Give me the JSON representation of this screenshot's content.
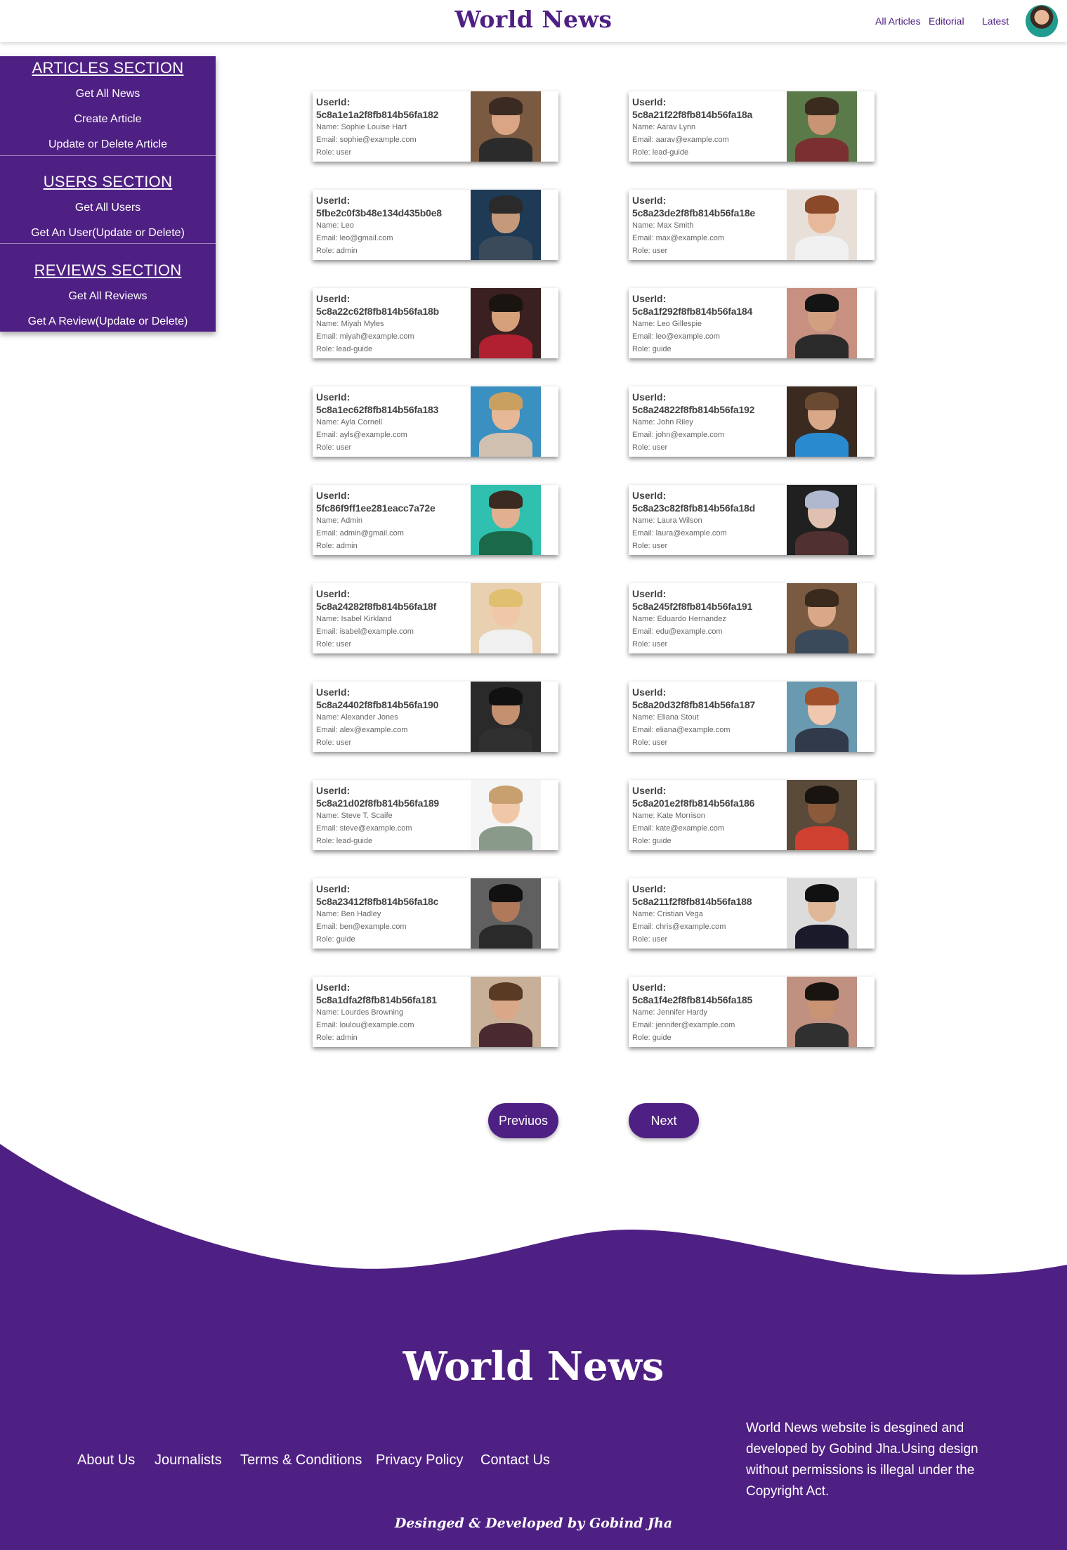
{
  "header": {
    "brand": "World News",
    "nav": [
      "All Articles",
      "Editorial",
      "Latest"
    ]
  },
  "sidebar": {
    "sections": [
      {
        "title": "ARTICLES SECTION",
        "links": [
          "Get All News",
          "Create Article",
          "Update or Delete Article"
        ]
      },
      {
        "title": "USERS SECTION",
        "links": [
          "Get All Users",
          "Get An User(Update or Delete)"
        ]
      },
      {
        "title": "REVIEWS SECTION",
        "links": [
          "Get All Reviews",
          "Get A Review(Update or Delete)"
        ]
      }
    ]
  },
  "users": [
    {
      "label": "UserId:",
      "id": "5c8a1e1a2f8fb814b56fa182",
      "name": "Name: Sophie Louise Hart",
      "email": "Email: sophie@example.com",
      "role": "Role: user"
    },
    {
      "label": "UserId:",
      "id": "5c8a21f22f8fb814b56fa18a",
      "name": "Name: Aarav Lynn",
      "email": "Email: aarav@example.com",
      "role": "Role: lead-guide"
    },
    {
      "label": "UserId:",
      "id": "5fbe2c0f3b48e134d435b0e8",
      "name": "Name: Leo",
      "email": "Email: leo@gmail.com",
      "role": "Role: admin"
    },
    {
      "label": "UserId:",
      "id": "5c8a23de2f8fb814b56fa18e",
      "name": "Name: Max Smith",
      "email": "Email: max@example.com",
      "role": "Role: user"
    },
    {
      "label": "UserId:",
      "id": "5c8a22c62f8fb814b56fa18b",
      "name": "Name: Miyah Myles",
      "email": "Email: miyah@example.com",
      "role": "Role: lead-guide"
    },
    {
      "label": "UserId:",
      "id": "5c8a1f292f8fb814b56fa184",
      "name": "Name: Leo Gillespie",
      "email": "Email: leo@example.com",
      "role": "Role: guide"
    },
    {
      "label": "UserId:",
      "id": "5c8a1ec62f8fb814b56fa183",
      "name": "Name: Ayla Cornell",
      "email": "Email: ayls@example.com",
      "role": "Role: user"
    },
    {
      "label": "UserId:",
      "id": "5c8a24822f8fb814b56fa192",
      "name": "Name: John Riley",
      "email": "Email: john@example.com",
      "role": "Role: user"
    },
    {
      "label": "UserId:",
      "id": "5fc86f9ff1ee281eacc7a72e",
      "name": "Name: Admin",
      "email": "Email: admin@gmail.com",
      "role": "Role: admin"
    },
    {
      "label": "UserId:",
      "id": "5c8a23c82f8fb814b56fa18d",
      "name": "Name: Laura Wilson",
      "email": "Email: laura@example.com",
      "role": "Role: user"
    },
    {
      "label": "UserId:",
      "id": "5c8a24282f8fb814b56fa18f",
      "name": "Name: Isabel Kirkland",
      "email": "Email: isabel@example.com",
      "role": "Role: user"
    },
    {
      "label": "UserId:",
      "id": "5c8a245f2f8fb814b56fa191",
      "name": "Name: Eduardo Hernandez",
      "email": "Email: edu@example.com",
      "role": "Role: user"
    },
    {
      "label": "UserId:",
      "id": "5c8a24402f8fb814b56fa190",
      "name": "Name: Alexander Jones",
      "email": "Email: alex@example.com",
      "role": "Role: user"
    },
    {
      "label": "UserId:",
      "id": "5c8a20d32f8fb814b56fa187",
      "name": "Name: Eliana Stout",
      "email": "Email: eliana@example.com",
      "role": "Role: user"
    },
    {
      "label": "UserId:",
      "id": "5c8a21d02f8fb814b56fa189",
      "name": "Name: Steve T. Scaife",
      "email": "Email: steve@example.com",
      "role": "Role: lead-guide"
    },
    {
      "label": "UserId:",
      "id": "5c8a201e2f8fb814b56fa186",
      "name": "Name: Kate Morrison",
      "email": "Email: kate@example.com",
      "role": "Role: guide"
    },
    {
      "label": "UserId:",
      "id": "5c8a23412f8fb814b56fa18c",
      "name": "Name: Ben Hadley",
      "email": "Email: ben@example.com",
      "role": "Role: guide"
    },
    {
      "label": "UserId:",
      "id": "5c8a211f2f8fb814b56fa188",
      "name": "Name: Cristian Vega",
      "email": "Email: chris@example.com",
      "role": "Role: user"
    },
    {
      "label": "UserId:",
      "id": "5c8a1dfa2f8fb814b56fa181",
      "name": "Name: Lourdes Browning",
      "email": "Email: loulou@example.com",
      "role": "Role: admin"
    },
    {
      "label": "UserId:",
      "id": "5c8a1f4e2f8fb814b56fa185",
      "name": "Name: Jennifer Hardy",
      "email": "Email: jennifer@example.com",
      "role": "Role: guide"
    }
  ],
  "pagination": {
    "prev": "Previuos",
    "next": "Next"
  },
  "footer": {
    "brand": "World News",
    "links": [
      "About Us",
      "Journalists",
      "Terms & Conditions",
      "Privacy Policy",
      "Contact Us"
    ],
    "about": "World News website is desgined and developed by Gobind Jha.Using design without permissions is illegal under the Copyright Act.",
    "credit": "Desinged & Developed by Gobind Jha"
  },
  "colors": {
    "brand_purple": "#4f2083",
    "card_bg": "#ffffff"
  }
}
